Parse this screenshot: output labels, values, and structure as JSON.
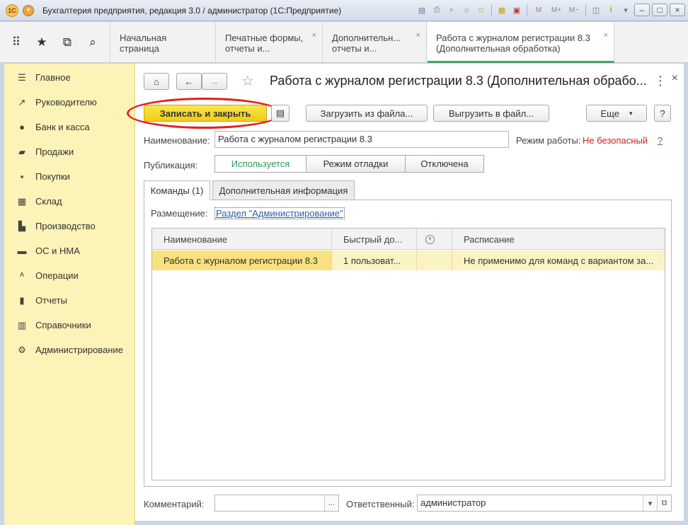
{
  "window": {
    "title": "Бухгалтерия предприятия, редакция 3.0 / администратор  (1С:Предприятие)",
    "logo_text": "1С",
    "tools": [
      "save-icon",
      "print-icon",
      "find-icon",
      "favorites-add-icon",
      "favorites-icon",
      "spreadsheet-icon",
      "calendar-icon"
    ],
    "memory_buttons": [
      "M",
      "M+",
      "M−"
    ],
    "info_icon": "i",
    "minimize": "–",
    "maximize": "□",
    "close": "×"
  },
  "tabs": [
    {
      "label": "Начальная страница",
      "closable": false
    },
    {
      "label": "Печатные формы, отчеты и...",
      "closable": true
    },
    {
      "label": "Дополнительн... отчеты и...",
      "closable": true
    },
    {
      "label": "Работа с журналом регистрации 8.3 (Дополнительная обработка)",
      "closable": true,
      "active": true
    }
  ],
  "sidebar": {
    "items": [
      {
        "label": "Главное",
        "icon": "menu-icon"
      },
      {
        "label": "Руководителю",
        "icon": "trend-icon"
      },
      {
        "label": "Банк и касса",
        "icon": "coin-icon"
      },
      {
        "label": "Продажи",
        "icon": "bag-icon"
      },
      {
        "label": "Покупки",
        "icon": "cart-icon"
      },
      {
        "label": "Склад",
        "icon": "warehouse-icon"
      },
      {
        "label": "Производство",
        "icon": "factory-icon"
      },
      {
        "label": "ОС и НМА",
        "icon": "truck-icon"
      },
      {
        "label": "Операции",
        "icon": "operations-icon"
      },
      {
        "label": "Отчеты",
        "icon": "chart-icon"
      },
      {
        "label": "Справочники",
        "icon": "book-icon"
      },
      {
        "label": "Администрирование",
        "icon": "gear-icon"
      }
    ]
  },
  "form": {
    "title": "Работа с журналом регистрации 8.3 (Дополнительная обрабо...",
    "save_close": "Записать и закрыть",
    "load_file": "Загрузить из файла...",
    "unload_file": "Выгрузить в файл...",
    "more": "Еще",
    "help": "?",
    "name_label": "Наименование:",
    "name_value": "Работа с журналом регистрации 8.3",
    "mode_label": "Режим работы:",
    "mode_value": "Не безопасный",
    "mode_help": "?",
    "publication_label": "Публикация:",
    "publication_options": [
      "Используется",
      "Режим отладки",
      "Отключена"
    ],
    "tabs": [
      "Команды (1)",
      "Дополнительная информация"
    ],
    "placement_label": "Размещение:",
    "placement_link": "Раздел \"Администрирование\"",
    "table": {
      "columns": [
        "Наименование",
        "Быстрый до...",
        "",
        "Расписание"
      ],
      "rows": [
        [
          "Работа с журналом регистрации 8.3",
          "1 пользоват...",
          "",
          "Не применимо для команд с вариантом за..."
        ]
      ]
    },
    "comment_label": "Комментарий:",
    "comment_value": "",
    "comment_btn": "...",
    "responsible_label": "Ответственный:",
    "responsible_value": "администратор"
  }
}
